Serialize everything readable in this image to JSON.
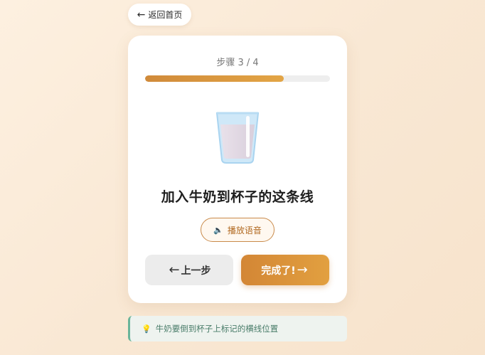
{
  "back": {
    "arrow": "←",
    "label": "返回首页"
  },
  "step": {
    "label": "步骤 3 / 4",
    "progress": 0.75
  },
  "illustration": {
    "icon": "glass-of-milk-icon"
  },
  "instruction": "加入牛奶到杯子的这条线",
  "voice": {
    "icon": "🔈",
    "label": "播放语音"
  },
  "nav": {
    "prev_arrow": "←",
    "prev_label": "上一步",
    "next_label": "完成了!",
    "next_arrow": "→"
  },
  "tip": {
    "icon": "💡",
    "text": "牛奶要倒到杯子上标记的横线位置"
  },
  "colors": {
    "accent": "#d38635",
    "tip_border": "#6ab59a"
  }
}
